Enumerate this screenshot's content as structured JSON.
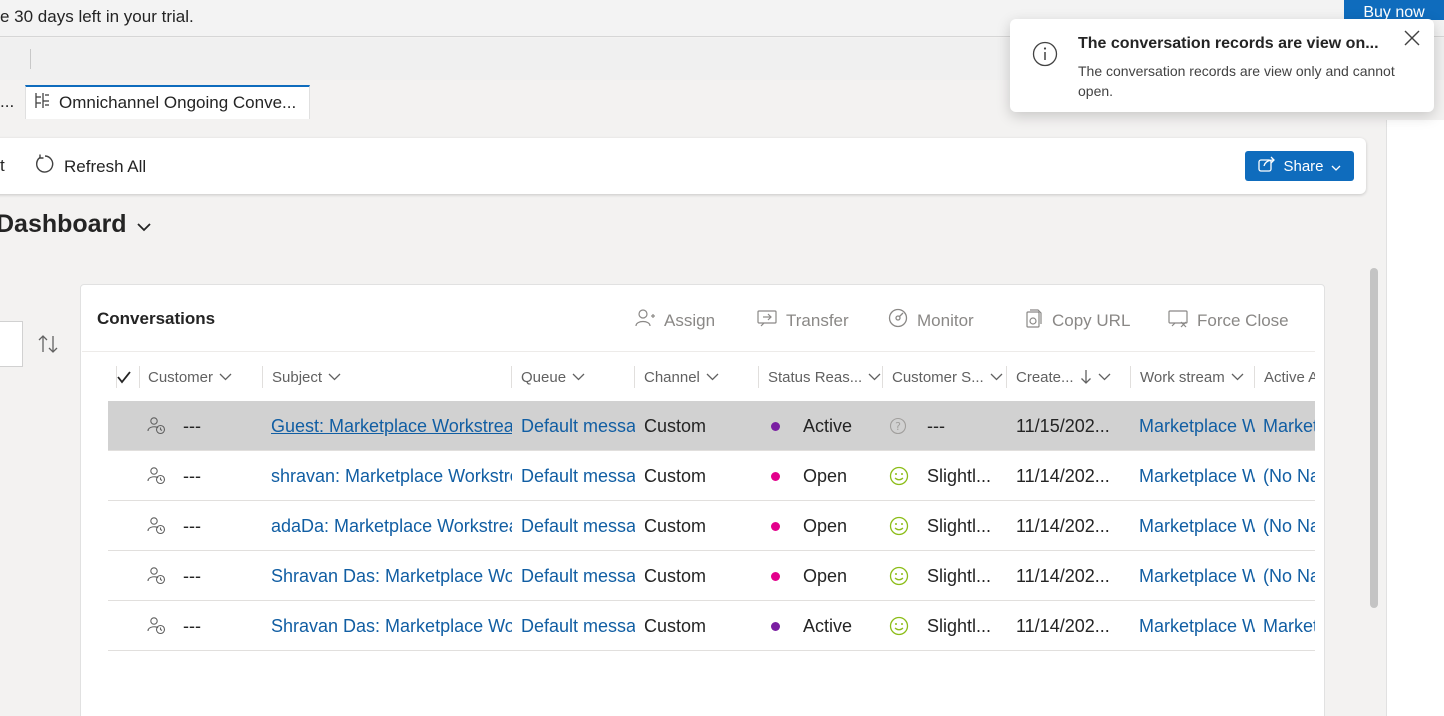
{
  "trial": {
    "text": "e 30 days left in your trial.",
    "buy_label": "Buy now"
  },
  "tabs": {
    "prev_label": "...",
    "active_label": "Omnichannel Ongoing Conve..."
  },
  "commandbar": {
    "cut_label": "t",
    "refresh_label": "Refresh All",
    "share_label": "Share"
  },
  "dashboard": {
    "title": "Dashboard"
  },
  "grid": {
    "title": "Conversations",
    "actions": [
      {
        "label": "Assign",
        "icon": "person-add-icon"
      },
      {
        "label": "Transfer",
        "icon": "transfer-icon"
      },
      {
        "label": "Monitor",
        "icon": "monitor-icon"
      },
      {
        "label": "Copy URL",
        "icon": "copy-url-icon"
      },
      {
        "label": "Force Close",
        "icon": "force-close-icon"
      }
    ],
    "columns": [
      "Customer",
      "Subject",
      "Queue",
      "Channel",
      "Status Reas...",
      "Customer S...",
      "Create...",
      "Work stream",
      "Active A"
    ],
    "rows": [
      {
        "customer": "---",
        "subject": "Guest: Marketplace Workstream",
        "queue": "Default messag",
        "channel": "Custom",
        "status": "Active",
        "status_color": "#7a1fa2",
        "sentiment": "---",
        "sentiment_icon": "unknown-sentiment-icon",
        "created": "11/15/202...",
        "workstream": "Marketplace W",
        "active_agent": "Market"
      },
      {
        "customer": "---",
        "subject": "shravan: Marketplace Workstream",
        "queue": "Default messag",
        "channel": "Custom",
        "status": "Open",
        "status_color": "#e3008c",
        "sentiment": "Slightl...",
        "sentiment_icon": "smiley-icon",
        "created": "11/14/202...",
        "workstream": "Marketplace W",
        "active_agent": "(No Na"
      },
      {
        "customer": "---",
        "subject": "adaDa: Marketplace Workstream",
        "queue": "Default messag",
        "channel": "Custom",
        "status": "Open",
        "status_color": "#e3008c",
        "sentiment": "Slightl...",
        "sentiment_icon": "smiley-icon",
        "created": "11/14/202...",
        "workstream": "Marketplace W",
        "active_agent": "(No Na"
      },
      {
        "customer": "---",
        "subject": "Shravan Das: Marketplace Work",
        "queue": "Default messag",
        "channel": "Custom",
        "status": "Open",
        "status_color": "#e3008c",
        "sentiment": "Slightl...",
        "sentiment_icon": "smiley-icon",
        "created": "11/14/202...",
        "workstream": "Marketplace W",
        "active_agent": "(No Na"
      },
      {
        "customer": "---",
        "subject": "Shravan Das: Marketplace Work",
        "queue": "Default messag",
        "channel": "Custom",
        "status": "Active",
        "status_color": "#7a1fa2",
        "sentiment": "Slightl...",
        "sentiment_icon": "smiley-icon",
        "created": "11/14/202...",
        "workstream": "Marketplace W",
        "active_agent": "Market"
      }
    ]
  },
  "toast": {
    "title": "The conversation records are view on...",
    "message": "The conversation records are view only and cannot open."
  }
}
